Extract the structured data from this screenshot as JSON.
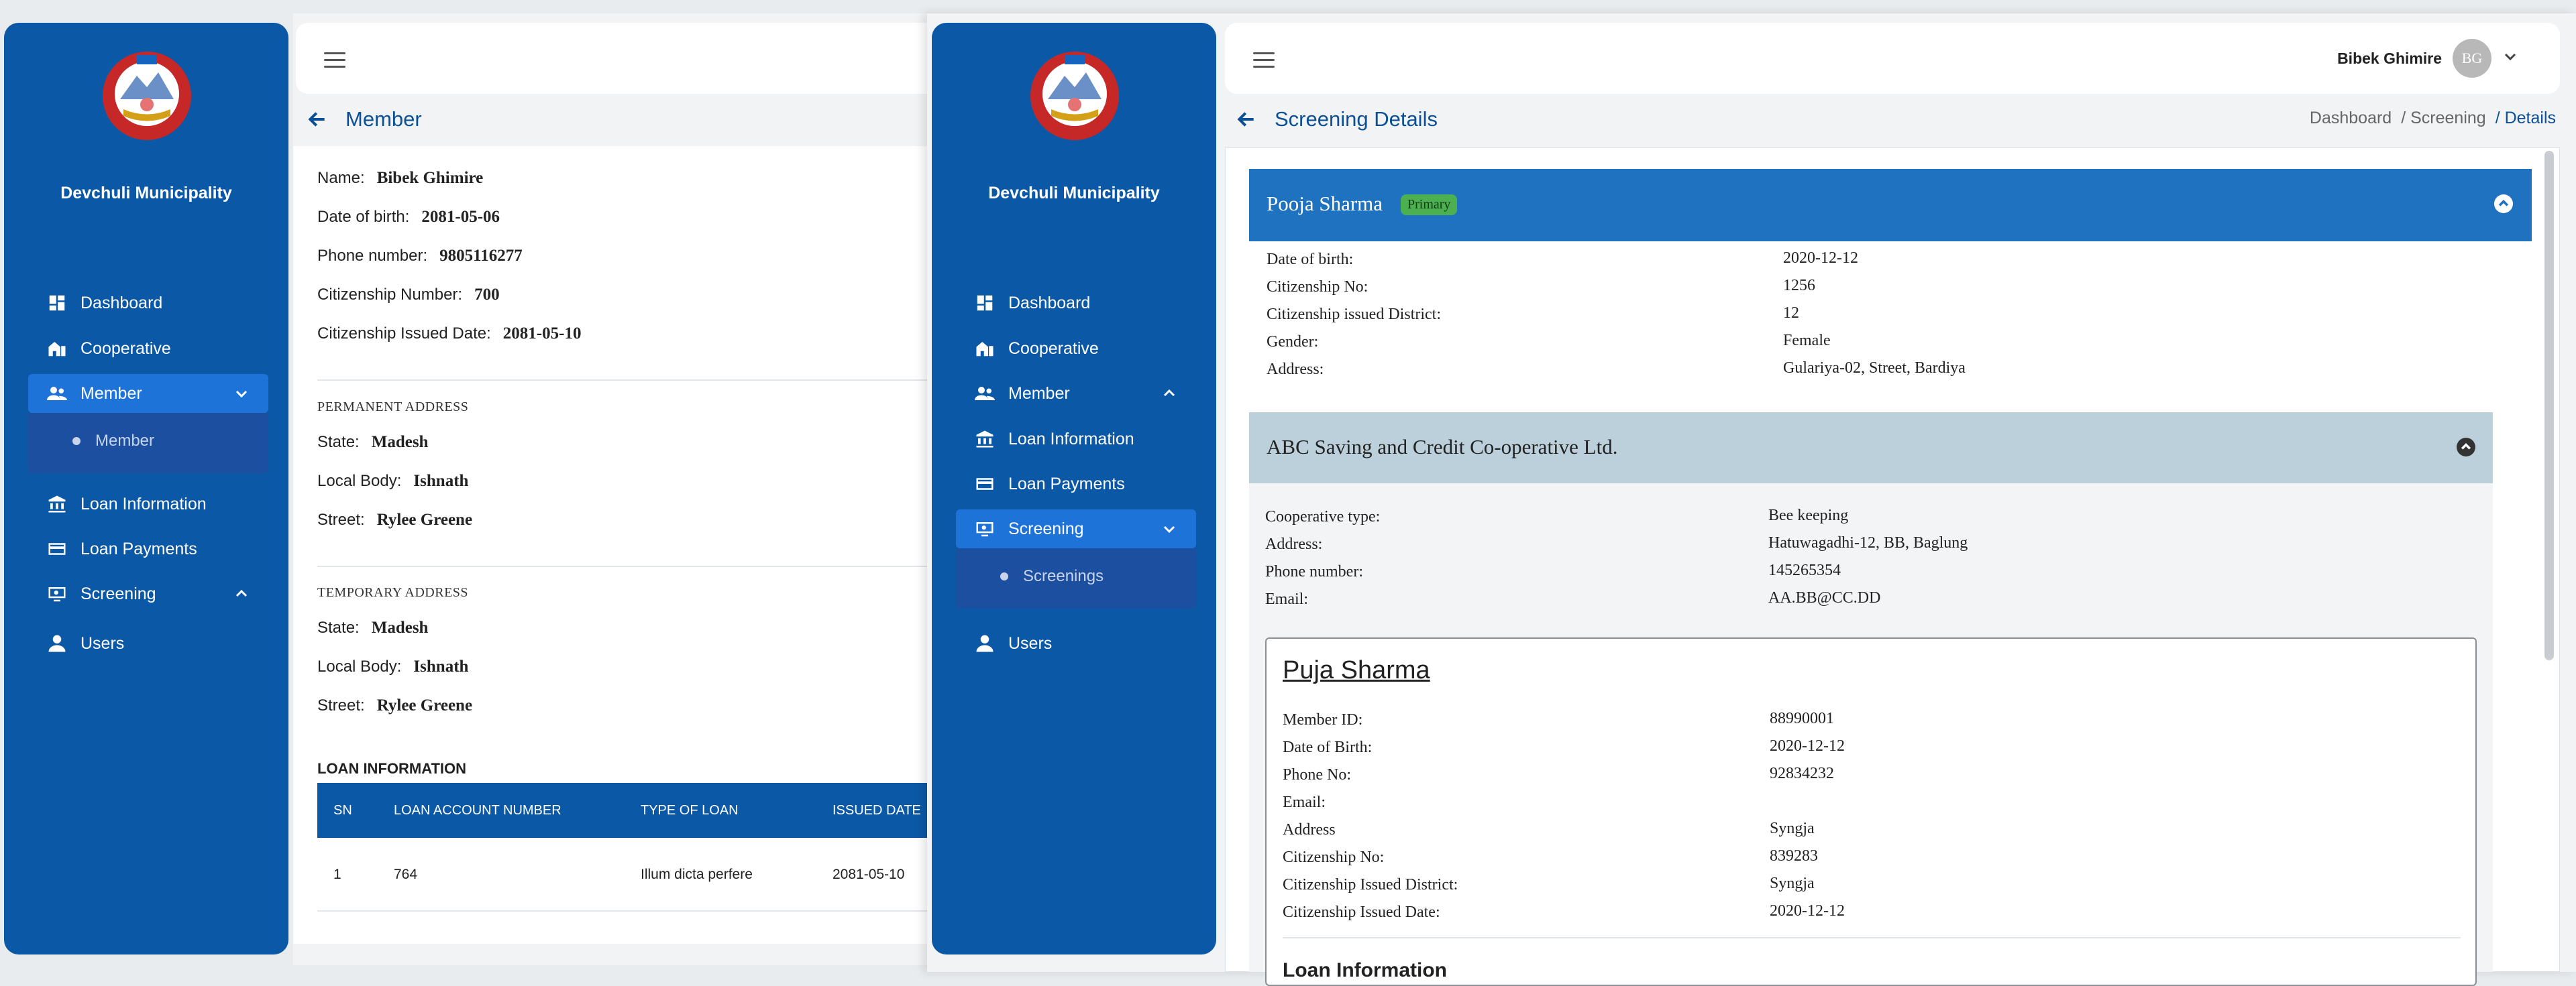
{
  "sidebar": {
    "title": "Devchuli Municipality",
    "items": {
      "dashboard": "Dashboard",
      "cooperative": "Cooperative",
      "member": "Member",
      "loan_information": "Loan Information",
      "loan_payments": "Loan Payments",
      "screening": "Screening",
      "users": "Users"
    },
    "sub_member": "Member",
    "sub_screenings": "Screenings"
  },
  "left_page": {
    "title": "Member",
    "personal": {
      "name_label": "Name:",
      "name": "Bibek Ghimire",
      "dob_label": "Date of birth:",
      "dob": "2081-05-06",
      "phone_label": "Phone number:",
      "phone": "9805116277",
      "citizenship_label": "Citizenship Number:",
      "citizenship": "700",
      "cit_issued_label": "Citizenship Issued Date:",
      "cit_issued": "2081-05-10"
    },
    "permanent": {
      "heading": "PERMANENT ADDRESS",
      "state_label": "State:",
      "state": "Madesh",
      "local_label": "Local Body:",
      "local": "Ishnath",
      "street_label": "Street:",
      "street": "Rylee Greene"
    },
    "temporary": {
      "heading": "TEMPORARY ADDRESS",
      "state_label": "State:",
      "state": "Madesh",
      "local_label": "Local Body:",
      "local": "Ishnath",
      "street_label": "Street:",
      "street": "Rylee Greene"
    },
    "loan": {
      "heading": "LOAN INFORMATION",
      "columns": [
        "SN",
        "LOAN ACCOUNT NUMBER",
        "TYPE OF LOAN",
        "ISSUED DATE"
      ],
      "rows": [
        [
          "1",
          "764",
          "Illum dicta perfere",
          "2081-05-10"
        ]
      ]
    }
  },
  "right_page": {
    "user_name": "Bibek Ghimire",
    "avatar_initials": "BG",
    "title": "Screening Details",
    "breadcrumb": [
      "Dashboard",
      "/ Screening",
      "/ Details"
    ],
    "primary": {
      "name": "Pooja Sharma",
      "badge": "Primary",
      "fields": [
        {
          "label": "Date of birth:",
          "value": "2020-12-12"
        },
        {
          "label": "Citizenship No:",
          "value": "1256"
        },
        {
          "label": "Citizenship issued District:",
          "value": "12"
        },
        {
          "label": "Gender:",
          "value": "Female"
        },
        {
          "label": "Address:",
          "value": "Gulariya-02, Street, Bardiya"
        }
      ]
    },
    "cooperative": {
      "name": "ABC Saving and Credit Co-operative Ltd.",
      "fields": [
        {
          "label": "Cooperative type:",
          "value": "Bee keeping"
        },
        {
          "label": "Address:",
          "value": "Hatuwagadhi-12, BB, Baglung"
        },
        {
          "label": "Phone number:",
          "value": "145265354"
        },
        {
          "label": "Email:",
          "value": "AA.BB@CC.DD"
        }
      ]
    },
    "member": {
      "name": "Puja Sharma",
      "fields": [
        {
          "label": "Member ID:",
          "value": "88990001"
        },
        {
          "label": "Date of Birth:",
          "value": "2020-12-12"
        },
        {
          "label": "Phone No:",
          "value": "92834232"
        },
        {
          "label": "Email:",
          "value": ""
        },
        {
          "label": "Address",
          "value": "Syngja"
        },
        {
          "label": "Citizenship No:",
          "value": "839283"
        },
        {
          "label": "Citizenship Issued District:",
          "value": "Syngja"
        },
        {
          "label": "Citizenship Issued Date:",
          "value": "2020-12-12"
        }
      ],
      "loan_heading": "Loan Information"
    }
  }
}
